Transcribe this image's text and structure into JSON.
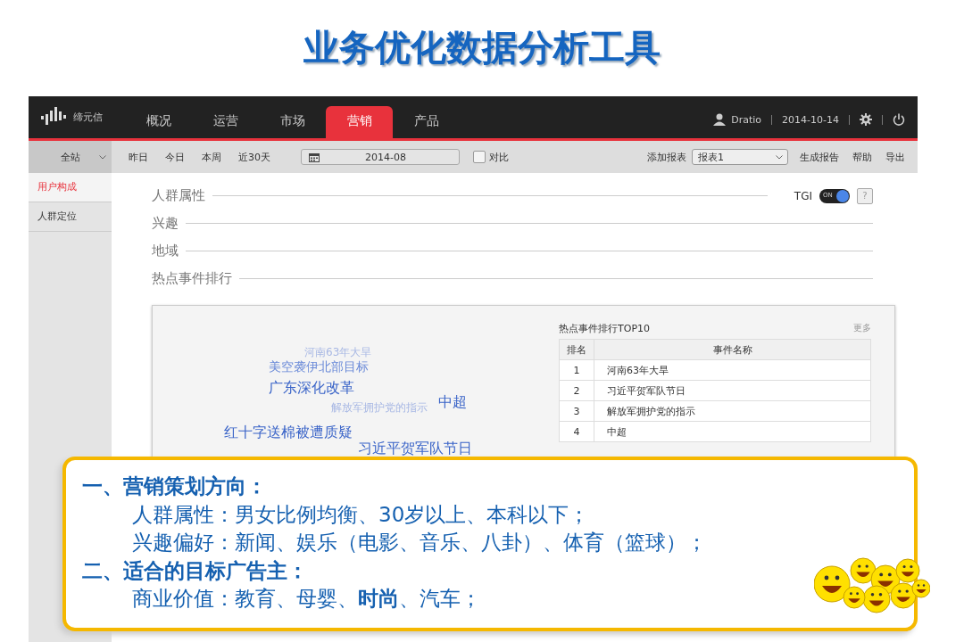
{
  "slide_title": "业务优化数据分析工具",
  "app": {
    "logo_text": "缔元信",
    "nav": [
      {
        "label": "概况",
        "selected": false
      },
      {
        "label": "运营",
        "selected": false
      },
      {
        "label": "市场",
        "selected": false
      },
      {
        "label": "营销",
        "selected": true
      },
      {
        "label": "产品",
        "selected": false
      }
    ],
    "user": "Dratio",
    "date": "2014-10-14",
    "site_select": "全站",
    "quick_ranges": [
      "昨日",
      "今日",
      "本周",
      "近30天"
    ],
    "month_field": "2014-08",
    "compare": {
      "label": "对比",
      "checked": false
    },
    "add_report_label": "添加报表",
    "report_select": "报表1",
    "actions": [
      "生成报告",
      "帮助",
      "导出"
    ],
    "sidebar": [
      {
        "label": "用户构成",
        "selected": true
      },
      {
        "label": "人群定位",
        "selected": false
      }
    ],
    "sections": [
      "人群属性",
      "兴趣",
      "地域",
      "热点事件排行"
    ],
    "tgi": {
      "label": "TGI",
      "toggle_text": "ON",
      "on": true,
      "help": "?"
    },
    "word_cloud": [
      {
        "text": "河南63年大旱",
        "kind": "minor"
      },
      {
        "text": "美空袭伊北部目标",
        "kind": "mid"
      },
      {
        "text": "广东深化改革",
        "kind": "major"
      },
      {
        "text": "解放军拥护党的指示",
        "kind": "minor"
      },
      {
        "text": "中超",
        "kind": "major"
      },
      {
        "text": "红十字送棉被遭质疑",
        "kind": "major"
      },
      {
        "text": "习近平贺军队节日",
        "kind": "major"
      }
    ],
    "top10": {
      "title": "热点事件排行TOP10",
      "more": "更多",
      "columns": [
        "排名",
        "事件名称"
      ],
      "rows": [
        [
          "1",
          "河南63年大旱"
        ],
        [
          "2",
          "习近平贺军队节日"
        ],
        [
          "3",
          "解放军拥护党的指示"
        ],
        [
          "4",
          "中超"
        ]
      ]
    }
  },
  "callout": [
    {
      "kind": "heading",
      "text": "一、营销策划方向："
    },
    {
      "kind": "item",
      "text": "人群属性：男女比例均衡、30岁以上、本科以下；"
    },
    {
      "kind": "item",
      "text": "兴趣偏好：新闻、娱乐（电影、音乐、八卦）、体育（篮球）；"
    },
    {
      "kind": "heading",
      "text": "二、适合的目标广告主："
    },
    {
      "kind": "item",
      "text": "商业价值：教育、母婴、**时尚**、汽车；"
    }
  ]
}
